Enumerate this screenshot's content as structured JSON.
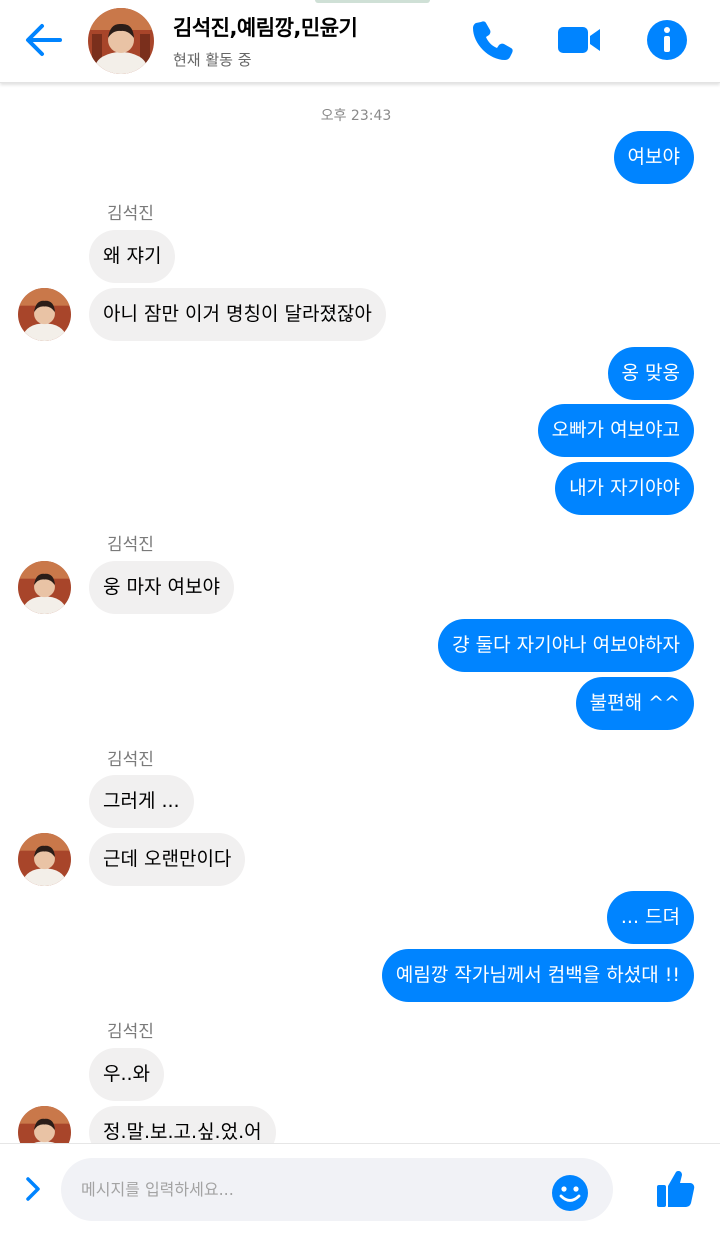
{
  "header": {
    "title": "김석진,예림깡,민윤기",
    "status": "현재 활동 중",
    "accent": "#0084ff"
  },
  "chat": {
    "timestamp": "오후 23:43",
    "sender": "김석진",
    "messages": [
      {
        "dir": "out",
        "text": "여보야"
      },
      {
        "dir": "in",
        "text": "왜 쟈기"
      },
      {
        "dir": "in",
        "text": "아니 잠만 이거 명칭이 달라졌잖아"
      },
      {
        "dir": "out",
        "text": "옹 맞옹"
      },
      {
        "dir": "out",
        "text": "오빠가 여보야고"
      },
      {
        "dir": "out",
        "text": "내가 자기야야"
      },
      {
        "dir": "in",
        "text": "웅 마자 여보야"
      },
      {
        "dir": "out",
        "text": "걍 둘다 자기야나 여보야하자"
      },
      {
        "dir": "out",
        "text": "불편해 ^^"
      },
      {
        "dir": "in",
        "text": "그러게 ..."
      },
      {
        "dir": "in",
        "text": "근데 오랜만이다"
      },
      {
        "dir": "out",
        "text": "... 드뎌"
      },
      {
        "dir": "out",
        "text": "예림깡 작가님께서 컴백을 하셨대 !!"
      },
      {
        "dir": "in",
        "text": "우..와"
      },
      {
        "dir": "in",
        "text": "정.말.보.고.싶.었.어"
      }
    ]
  },
  "composer": {
    "placeholder": "메시지를 입력하세요..."
  },
  "icons": [
    "back-arrow-icon",
    "phone-icon",
    "video-camera-icon",
    "info-icon",
    "chevron-right-icon",
    "smiley-icon",
    "thumbs-up-icon"
  ]
}
